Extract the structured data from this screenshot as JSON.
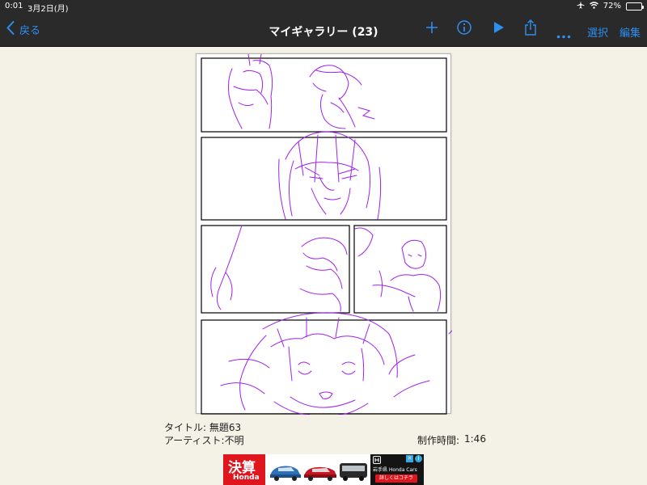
{
  "status_bar": {
    "time": "0:01",
    "date": "3月2日(月)",
    "battery_text": "72%",
    "battery_level": 0.72
  },
  "nav": {
    "back_label": "戻る",
    "title": "マイギャラリー (23)",
    "select_label": "選択",
    "edit_label": "編集"
  },
  "icons": {
    "back": "chevron-left-icon",
    "add": "plus-icon",
    "info": "info-icon",
    "play": "play-icon",
    "share": "share-icon",
    "more": "more-icon",
    "airplane": "airplane-icon",
    "wifi": "wifi-icon",
    "battery": "battery-icon"
  },
  "artwork": {
    "title_label": "タイトル: 無題63",
    "artist_label": "アーティスト:不明",
    "time_label": "制作時間:",
    "time_value": "1:46"
  },
  "ad": {
    "headline": "決算",
    "brand": "Honda",
    "dealer": "岩手県 Honda Cars",
    "cta": "詳しくはコチラ"
  },
  "colors": {
    "accent": "#2d8ff0",
    "nav_bg": "#2a2a2a",
    "background": "#f4f1e6",
    "sketch": "#a020f0",
    "ad_red": "#e0161e"
  }
}
